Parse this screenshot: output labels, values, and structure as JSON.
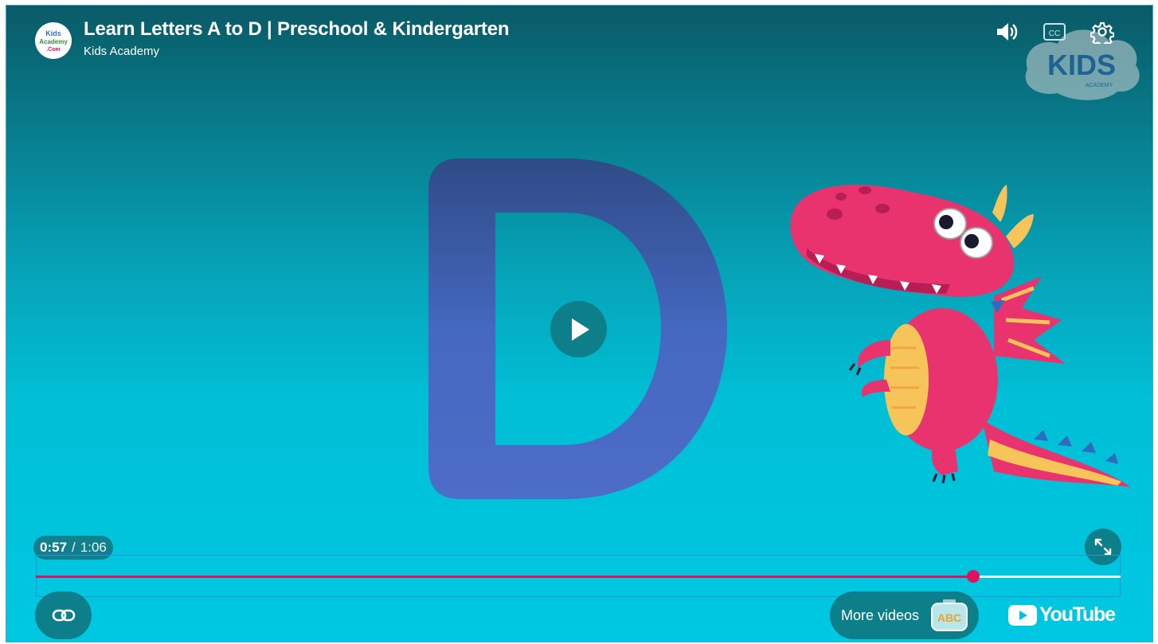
{
  "video": {
    "title": "Learn Letters A to D | Preschool & Kindergarten",
    "channel_name": "Kids Academy",
    "avatar_text": [
      "Kids",
      "Academy",
      ".Com"
    ],
    "watermark_text": "KIDS",
    "watermark_subtext": "ACADEMY",
    "featured_letter": "D"
  },
  "top_controls": {
    "volume_icon": "volume-icon",
    "captions_icon": "captions-icon",
    "captions_text": "CC",
    "settings_icon": "gear-icon"
  },
  "playback": {
    "current_time": "0:57",
    "separator": "/",
    "duration": "1:06",
    "progress_fraction": 0.864,
    "played_color": "#e0115f"
  },
  "bottom_controls": {
    "link_icon": "link-icon",
    "fullscreen_icon": "fullscreen-icon",
    "more_videos_label": "More videos",
    "more_videos_thumb_text": "ABC",
    "youtube_label": "YouTube"
  },
  "colors": {
    "accent": "#e0115f",
    "button_bg": "#0d7f8a",
    "letter": "#4a66bf",
    "dragon": "#e8336f"
  }
}
